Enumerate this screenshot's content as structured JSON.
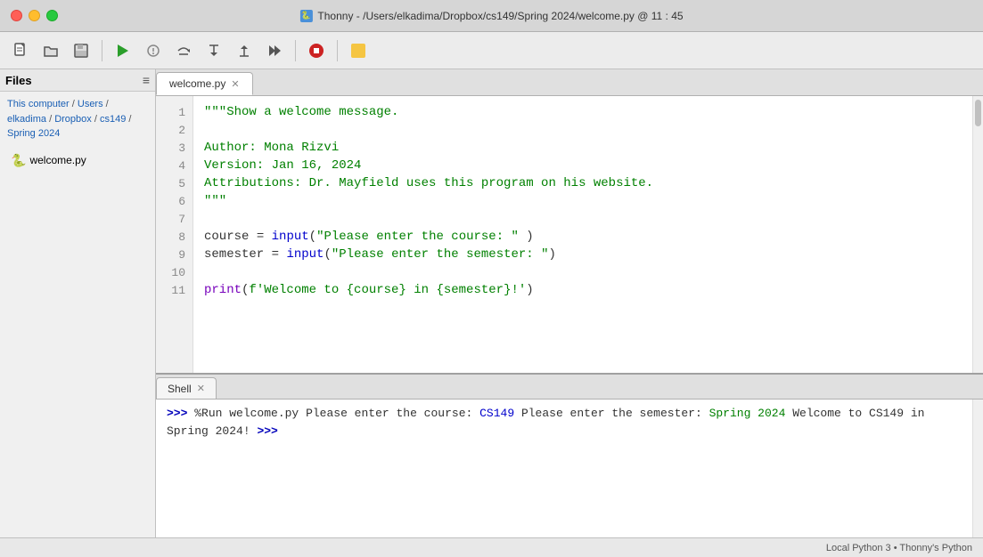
{
  "titlebar": {
    "title": "Thonny - /Users/elkadima/Dropbox/cs149/Spring 2024/welcome.py @ 11 : 45"
  },
  "toolbar": {
    "buttons": [
      {
        "name": "new-button",
        "icon": "📄",
        "label": "New"
      },
      {
        "name": "open-button",
        "icon": "📂",
        "label": "Open"
      },
      {
        "name": "save-button",
        "icon": "💾",
        "label": "Save"
      },
      {
        "name": "run-button",
        "icon": "▶",
        "label": "Run"
      },
      {
        "name": "debug-button",
        "icon": "🐛",
        "label": "Debug"
      },
      {
        "name": "step-over-button",
        "icon": "⏭",
        "label": "Step over"
      },
      {
        "name": "step-into-button",
        "icon": "⬇",
        "label": "Step into"
      },
      {
        "name": "step-out-button",
        "icon": "⬆",
        "label": "Step out"
      },
      {
        "name": "resume-button",
        "icon": "⏯",
        "label": "Resume"
      },
      {
        "name": "stop-button",
        "icon": "🛑",
        "label": "Stop"
      },
      {
        "name": "flag-icon",
        "icon": "🟨",
        "label": "Flag"
      }
    ]
  },
  "sidebar": {
    "header": "Files",
    "breadcrumb": {
      "thisComputer": "This computer",
      "sep1": " / ",
      "users": "Users",
      "sep2": " / ",
      "elkadima": "elkadima",
      "sep3": " / ",
      "dropbox": "Dropbox",
      "sep4": " / ",
      "cs149": "cs149",
      "sep5": " / ",
      "spring2024": "Spring 2024"
    },
    "file": {
      "name": "welcome.py",
      "icon": "🐍"
    }
  },
  "editor": {
    "tab": "welcome.py",
    "lines": [
      {
        "num": 1,
        "content": "\"\"\"Show a welcome message."
      },
      {
        "num": 2,
        "content": ""
      },
      {
        "num": 3,
        "content": "Author: Mona Rizvi"
      },
      {
        "num": 4,
        "content": "Version: Jan 16, 2024"
      },
      {
        "num": 5,
        "content": "Attributions: Dr. Mayfield uses this program on his website."
      },
      {
        "num": 6,
        "content": "\"\"\""
      },
      {
        "num": 7,
        "content": ""
      },
      {
        "num": 8,
        "content": "course = input(\"Please enter the course: \" )"
      },
      {
        "num": 9,
        "content": "semester = input(\"Please enter the semester: \")"
      },
      {
        "num": 10,
        "content": ""
      },
      {
        "num": 11,
        "content": "print(f'Welcome to {course} in {semester}!')"
      }
    ]
  },
  "shell": {
    "tab": "Shell",
    "lines": [
      {
        "type": "cmd",
        "content": ">>> %Run welcome.py"
      },
      {
        "type": "output",
        "content": "Please enter the course: CS149"
      },
      {
        "type": "output",
        "content": "Please enter the semester: Spring 2024"
      },
      {
        "type": "output",
        "content": "Welcome to CS149 in Spring 2024!"
      },
      {
        "type": "prompt",
        "content": ">>>"
      }
    ]
  },
  "statusbar": {
    "text": "Local Python 3  •  Thonny's Python"
  }
}
